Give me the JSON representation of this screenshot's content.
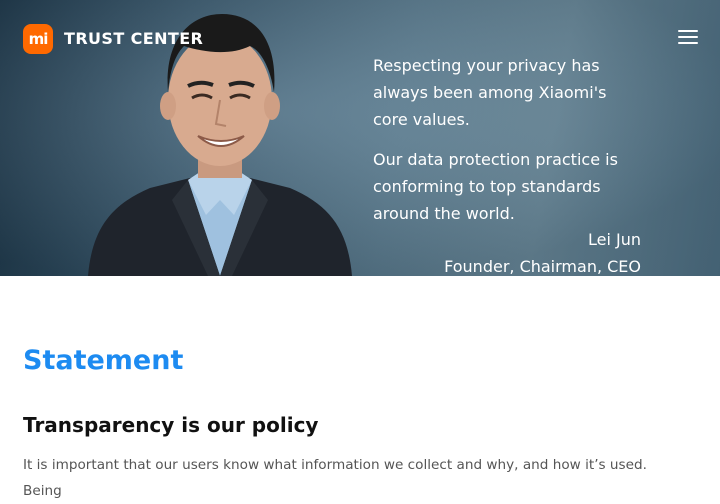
{
  "header": {
    "logo_text": "mi",
    "brand": "TRUST CENTER"
  },
  "hero": {
    "quote_lines": [
      "Respecting your privacy has always been among Xiaomi's core values.",
      "Our data protection practice is conforming to top standards around the world."
    ],
    "signature_name": "Lei Jun",
    "signature_title": "Founder, Chairman, CEO"
  },
  "main": {
    "section_title": "Statement",
    "subtitle": "Transparency is our policy",
    "paragraph": "It is important that our users know what information we collect and why, and how it’s used. Being"
  },
  "colors": {
    "accent": "#1d8bf1",
    "brand_orange": "#ff6900"
  },
  "icons": {
    "menu": "hamburger-menu-icon"
  }
}
